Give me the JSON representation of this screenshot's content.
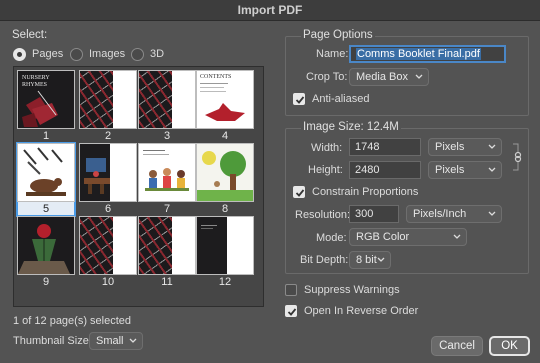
{
  "window": {
    "title": "Import PDF"
  },
  "select": {
    "title": "Select:",
    "options": [
      {
        "label": "Pages",
        "selected": true
      },
      {
        "label": "Images",
        "selected": false
      },
      {
        "label": "3D",
        "selected": false
      }
    ]
  },
  "thumbnails": {
    "pages": [
      {
        "number": "1",
        "title_line1": "NURSERY",
        "title_line2": "RHYMES"
      },
      {
        "number": "2"
      },
      {
        "number": "3"
      },
      {
        "number": "4",
        "title": "CONTENTS"
      },
      {
        "number": "5",
        "selected": true
      },
      {
        "number": "6"
      },
      {
        "number": "7"
      },
      {
        "number": "8"
      },
      {
        "number": "9"
      },
      {
        "number": "10"
      },
      {
        "number": "11"
      },
      {
        "number": "12"
      }
    ],
    "status": "1 of 12 page(s) selected",
    "size_label": "Thumbnail Size:",
    "size_value": "Small"
  },
  "page_options": {
    "title": "Page Options",
    "name_label": "Name:",
    "name_value": "Comms Booklet Final.pdf",
    "crop_label": "Crop To:",
    "crop_value": "Media Box",
    "anti_aliased_label": "Anti-aliased",
    "anti_aliased": true
  },
  "image_size": {
    "title": "Image Size: 12.4M",
    "width_label": "Width:",
    "width_value": "1748",
    "width_unit": "Pixels",
    "height_label": "Height:",
    "height_value": "2480",
    "height_unit": "Pixels",
    "constrain_label": "Constrain Proportions",
    "constrain": true,
    "resolution_label": "Resolution:",
    "resolution_value": "300",
    "resolution_unit": "Pixels/Inch",
    "mode_label": "Mode:",
    "mode_value": "RGB Color",
    "bit_depth_label": "Bit Depth:",
    "bit_depth_value": "8 bit"
  },
  "options": {
    "suppress_warnings_label": "Suppress Warnings",
    "suppress_warnings": false,
    "reverse_order_label": "Open In Reverse Order",
    "reverse_order": true
  },
  "buttons": {
    "cancel": "Cancel",
    "ok": "OK"
  }
}
